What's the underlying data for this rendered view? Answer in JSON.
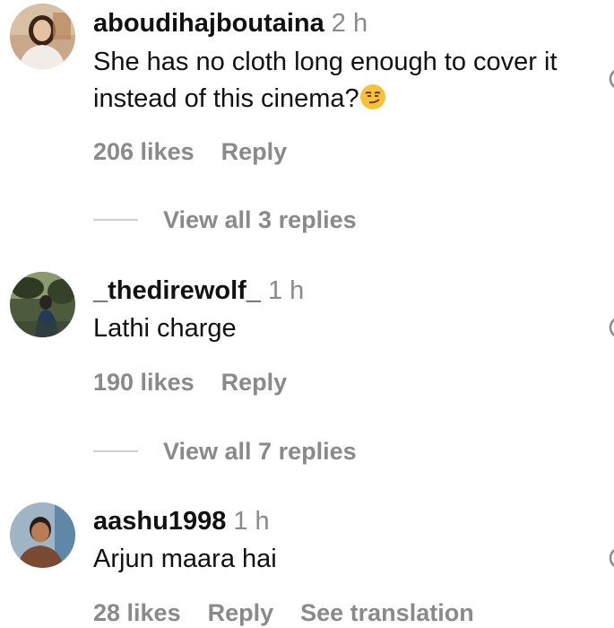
{
  "comments": [
    {
      "username": "aboudihajboutaina",
      "time": "2 h",
      "text": "She has no cloth long enough to cover it instead of this cinema?",
      "likes": "206 likes",
      "reply": "Reply",
      "view_replies": "View all 3 replies",
      "emoji": "smirking-face-emoji"
    },
    {
      "username": "_thedirewolf_",
      "time": "1 h",
      "text": "Lathi charge",
      "likes": "190 likes",
      "reply": "Reply",
      "view_replies": "View all 7 replies"
    },
    {
      "username": "aashu1998",
      "time": "1 h",
      "text": "Arjun maara hai",
      "likes": "28 likes",
      "reply": "Reply",
      "see_translation": "See translation"
    }
  ],
  "colors": {
    "text": "#111111",
    "secondary": "#8a8a8a",
    "divider": "#cfcfcf"
  }
}
